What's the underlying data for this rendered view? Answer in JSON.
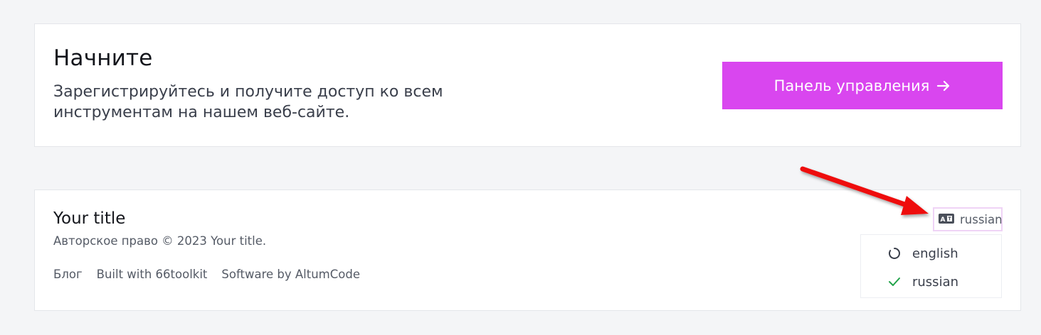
{
  "cta": {
    "title": "Начните",
    "text": "Зарегистрируйтесь и получите доступ ко всем инструментам на нашем веб-сайте.",
    "button_label": "Панель управления",
    "button_icon": "arrow-right-icon",
    "button_color": "#d946ef"
  },
  "footer": {
    "site_title": "Your title",
    "copyright": "Авторское право © 2023 Your title.",
    "links": [
      {
        "label": "Блог"
      },
      {
        "label": "Built with 66toolkit"
      },
      {
        "label": "Software by AltumCode"
      }
    ]
  },
  "language": {
    "current": "russian",
    "toggle_icon": "language-icon",
    "options": [
      {
        "label": "english",
        "icon": "circle-loading-icon",
        "selected": false
      },
      {
        "label": "russian",
        "icon": "check-icon",
        "selected": true
      }
    ],
    "check_color": "#22a34a"
  },
  "annotation": {
    "arrow_color": "#ee1111",
    "arrow_icon": "red-arrow-annotation"
  }
}
